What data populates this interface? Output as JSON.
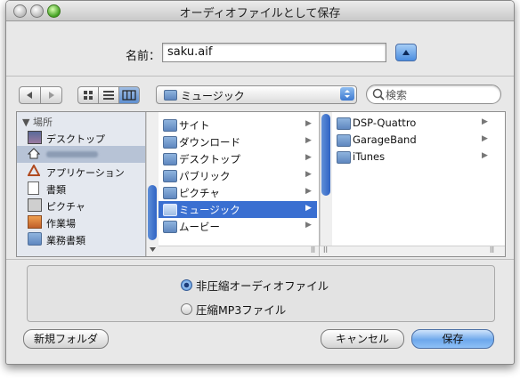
{
  "window": {
    "title": "オーディオファイルとして保存"
  },
  "name_row": {
    "label": "名前：",
    "value": "saku.aif"
  },
  "toolbar": {
    "location": "ミュージック",
    "search_placeholder": "検索"
  },
  "sidebar": {
    "header": "場所",
    "items": [
      {
        "label": "デスクトップ",
        "icon": "desktop-icon"
      },
      {
        "label": "",
        "icon": "home-icon",
        "selected": true
      },
      {
        "label": "アプリケーション",
        "icon": "applications-icon"
      },
      {
        "label": "書類",
        "icon": "documents-icon"
      },
      {
        "label": "ピクチャ",
        "icon": "pictures-icon"
      },
      {
        "label": "作業場",
        "icon": "workspace-icon"
      },
      {
        "label": "業務書類",
        "icon": "folder-icon"
      }
    ]
  },
  "column1": {
    "items": [
      {
        "label": "サイト",
        "icon": "sites-folder-icon"
      },
      {
        "label": "ダウンロード",
        "icon": "downloads-folder-icon"
      },
      {
        "label": "デスクトップ",
        "icon": "desktop-folder-icon"
      },
      {
        "label": "パブリック",
        "icon": "public-folder-icon"
      },
      {
        "label": "ピクチャ",
        "icon": "pictures-folder-icon"
      },
      {
        "label": "ミュージック",
        "icon": "music-folder-icon",
        "selected": true
      },
      {
        "label": "ムービー",
        "icon": "movies-folder-icon"
      }
    ]
  },
  "column2": {
    "items": [
      {
        "label": "DSP-Quattro",
        "icon": "folder-icon"
      },
      {
        "label": "GarageBand",
        "icon": "folder-icon"
      },
      {
        "label": "iTunes",
        "icon": "folder-icon"
      }
    ]
  },
  "format_options": {
    "option1": "非圧縮オーディオファイル",
    "option2": "圧縮MP3ファイル",
    "selected": "非圧縮オーディオファイル"
  },
  "buttons": {
    "new_folder": "新規フォルダ",
    "cancel": "キャンセル",
    "save": "保存"
  },
  "colors": {
    "selection": "#3a6fd1",
    "default_button": "#6ea8ec"
  }
}
